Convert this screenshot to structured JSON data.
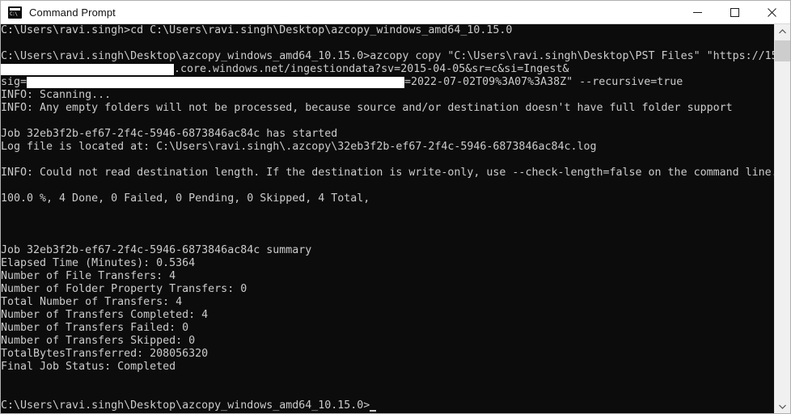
{
  "window": {
    "title": "Command Prompt",
    "icon": "command-prompt-icon",
    "controls": {
      "minimize": "Minimize",
      "maximize": "Maximize",
      "close": "Close"
    },
    "colors": {
      "titlebar_bg": "#ffffff",
      "console_bg": "#0c0c0c",
      "console_fg": "#cccccc",
      "redaction": "#ffffff",
      "scrollbar_thumb": "#cdcdcd"
    }
  },
  "scrollbar": {
    "up_arrow": "▲",
    "down_arrow": "▼"
  },
  "terminal": {
    "lines": [
      {
        "id": "cd-command",
        "text": "C:\\Users\\ravi.singh>cd C:\\Users\\ravi.singh\\Desktop\\azcopy_windows_amd64_10.15.0"
      },
      {
        "id": "blank-1",
        "text": ""
      },
      {
        "id": "azcopy-command",
        "text": "C:\\Users\\ravi.singh\\Desktop\\azcopy_windows_amd64_10.15.0>azcopy copy \"C:\\Users\\ravi.singh\\Desktop\\PST Files\" \"https://15"
      },
      {
        "id": "sas-url-line-1",
        "text": ".core.windows.net/ingestiondata?sv=2015-04-05&sr=c&si=Ingest&",
        "prefix_pad": 214
      },
      {
        "id": "sas-url-line-2",
        "text": "sig=",
        "suffix": "=2022-07-02T09%3A07%3A38Z\" --recursive=true",
        "suffix_pad": 499
      },
      {
        "id": "info-scanning",
        "text": "INFO: Scanning..."
      },
      {
        "id": "info-empty-folders",
        "text": "INFO: Any empty folders will not be processed, because source and/or destination doesn't have full folder support"
      },
      {
        "id": "blank-2",
        "text": ""
      },
      {
        "id": "job-started",
        "text": "Job 32eb3f2b-ef67-2f4c-5946-6873846ac84c has started"
      },
      {
        "id": "log-file-location",
        "text": "Log file is located at: C:\\Users\\ravi.singh\\.azcopy\\32eb3f2b-ef67-2f4c-5946-6873846ac84c.log"
      },
      {
        "id": "blank-3",
        "text": ""
      },
      {
        "id": "info-destination-length",
        "text": "INFO: Could not read destination length. If the destination is write-only, use --check-length=false on the command line."
      },
      {
        "id": "blank-4",
        "text": ""
      },
      {
        "id": "progress-line",
        "text": "100.0 %, 4 Done, 0 Failed, 0 Pending, 0 Skipped, 4 Total,"
      },
      {
        "id": "blank-5",
        "text": ""
      },
      {
        "id": "blank-6",
        "text": ""
      },
      {
        "id": "blank-7",
        "text": ""
      },
      {
        "id": "job-summary-header",
        "text": "Job 32eb3f2b-ef67-2f4c-5946-6873846ac84c summary"
      },
      {
        "id": "elapsed-time",
        "text": "Elapsed Time (Minutes): 0.5364"
      },
      {
        "id": "file-transfers",
        "text": "Number of File Transfers: 4"
      },
      {
        "id": "folder-property-transfers",
        "text": "Number of Folder Property Transfers: 0"
      },
      {
        "id": "total-transfers",
        "text": "Total Number of Transfers: 4"
      },
      {
        "id": "transfers-completed",
        "text": "Number of Transfers Completed: 4"
      },
      {
        "id": "transfers-failed",
        "text": "Number of Transfers Failed: 0"
      },
      {
        "id": "transfers-skipped",
        "text": "Number of Transfers Skipped: 0"
      },
      {
        "id": "total-bytes-transferred",
        "text": "TotalBytesTransferred: 208056320"
      },
      {
        "id": "final-job-status",
        "text": "Final Job Status: Completed"
      },
      {
        "id": "blank-8",
        "text": ""
      },
      {
        "id": "blank-9",
        "text": ""
      },
      {
        "id": "final-prompt",
        "text": "C:\\Users\\ravi.singh\\Desktop\\azcopy_windows_amd64_10.15.0>"
      }
    ]
  }
}
